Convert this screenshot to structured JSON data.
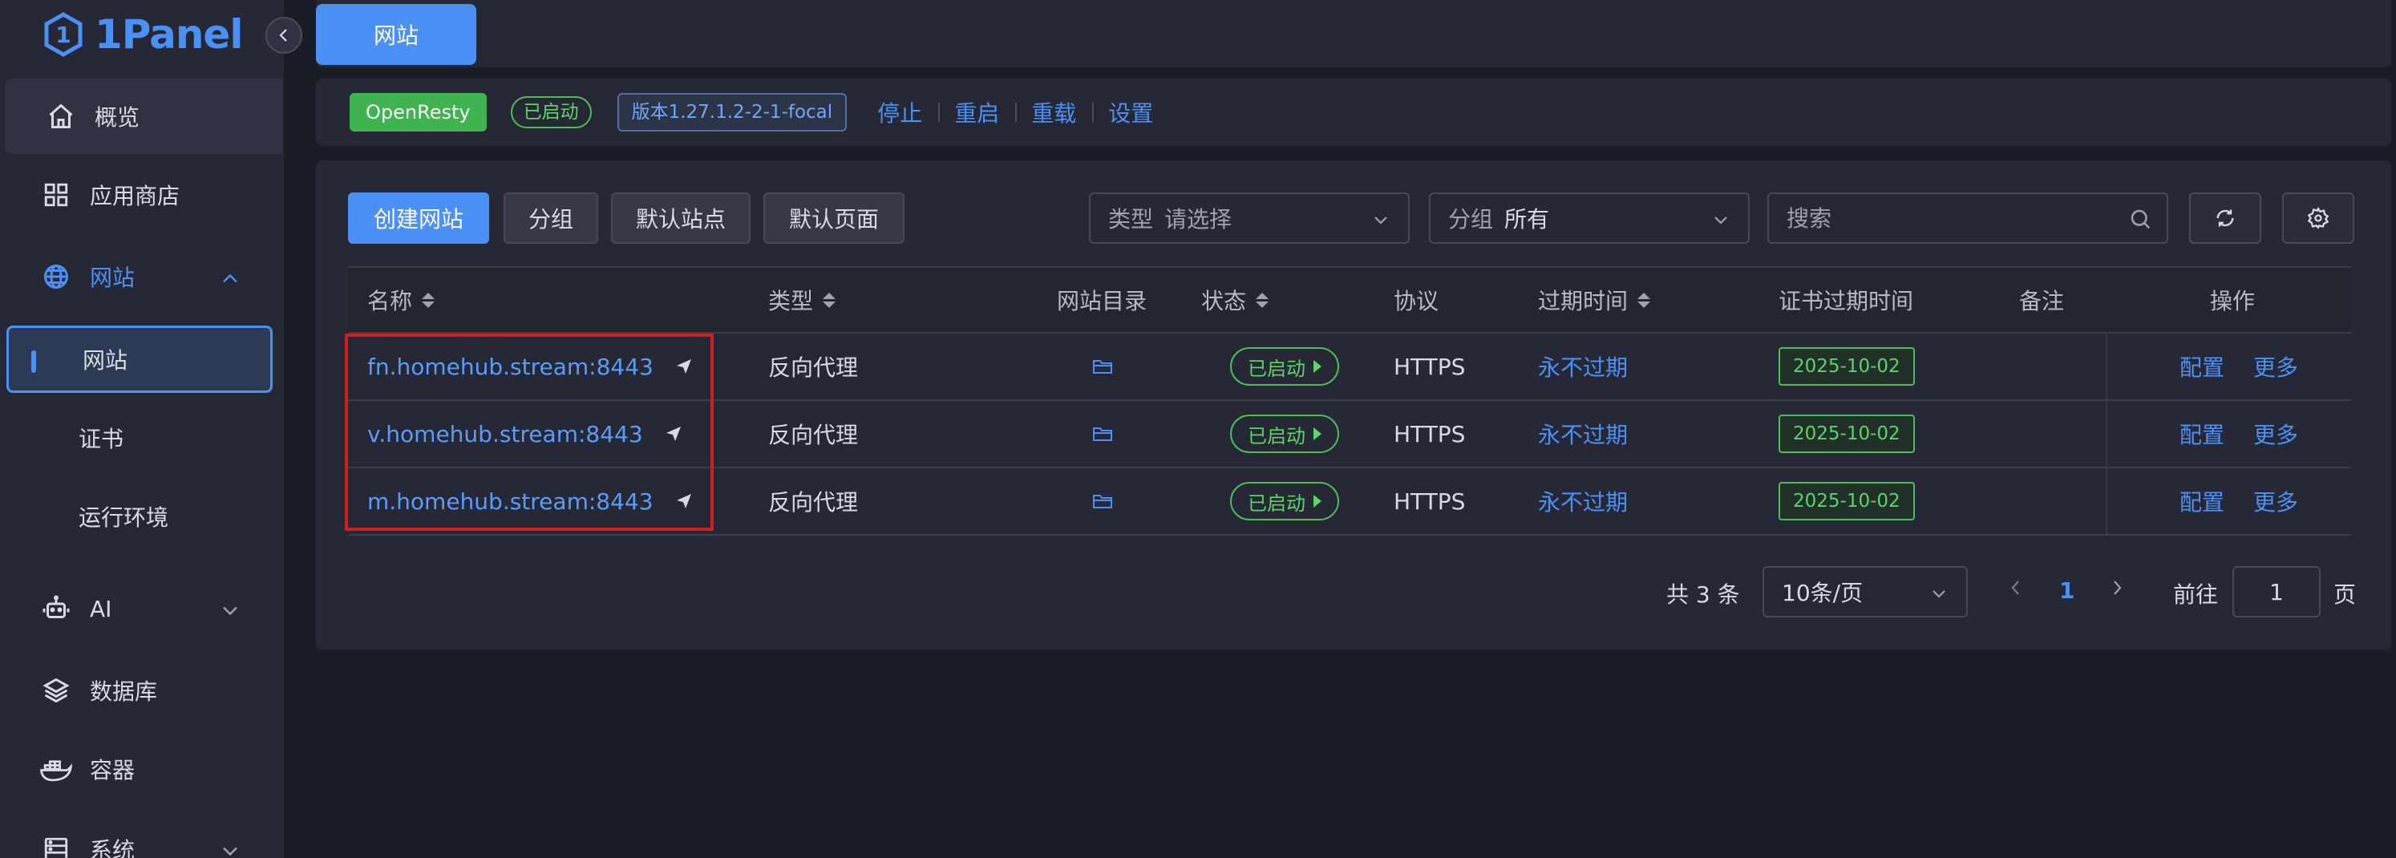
{
  "app": {
    "logo_text": "1Panel"
  },
  "sidebar": {
    "items": [
      {
        "label": "概览",
        "icon": "home-icon"
      },
      {
        "label": "应用商店",
        "icon": "grid-icon"
      },
      {
        "label": "网站",
        "icon": "globe-icon"
      },
      {
        "label": "AI",
        "icon": "robot-icon"
      },
      {
        "label": "数据库",
        "icon": "layers-icon"
      },
      {
        "label": "容器",
        "icon": "docker-icon"
      },
      {
        "label": "系统",
        "icon": "server-icon"
      }
    ],
    "website_sub": [
      "网站",
      "证书",
      "运行环境"
    ]
  },
  "tabbar": {
    "active_tab": "网站"
  },
  "appbar": {
    "app_name": "OpenResty",
    "status": "已启动",
    "version": "版本1.27.1.2-2-1-focal",
    "actions": [
      "停止",
      "重启",
      "重载",
      "设置"
    ]
  },
  "toolbar": {
    "create": "创建网站",
    "group": "分组",
    "default_site": "默认站点",
    "default_page": "默认页面",
    "type_prefix": "类型",
    "type_value": "请选择",
    "group_prefix": "分组",
    "group_value": "所有",
    "search_placeholder": "搜索"
  },
  "table": {
    "headers": {
      "name": "名称",
      "type": "类型",
      "dir": "网站目录",
      "status": "状态",
      "protocol": "协议",
      "expire": "过期时间",
      "cert_expire": "证书过期时间",
      "remark": "备注",
      "ops": "操作"
    },
    "rows": [
      {
        "name": "fn.homehub.stream:8443",
        "type": "反向代理",
        "status": "已启动",
        "protocol": "HTTPS",
        "expire": "永不过期",
        "cert_expire": "2025-10-02",
        "op1": "配置",
        "op2": "更多"
      },
      {
        "name": "v.homehub.stream:8443",
        "type": "反向代理",
        "status": "已启动",
        "protocol": "HTTPS",
        "expire": "永不过期",
        "cert_expire": "2025-10-02",
        "op1": "配置",
        "op2": "更多"
      },
      {
        "name": "m.homehub.stream:8443",
        "type": "反向代理",
        "status": "已启动",
        "protocol": "HTTPS",
        "expire": "永不过期",
        "cert_expire": "2025-10-02",
        "op1": "配置",
        "op2": "更多"
      }
    ]
  },
  "pagination": {
    "total": "共 3 条",
    "page_size": "10条/页",
    "current": "1",
    "goto_label": "前往",
    "goto_value": "1",
    "page_suffix": "页"
  },
  "colors": {
    "accent": "#4a90f5",
    "success": "#4dbd5a",
    "highlight": "#d41f22"
  }
}
